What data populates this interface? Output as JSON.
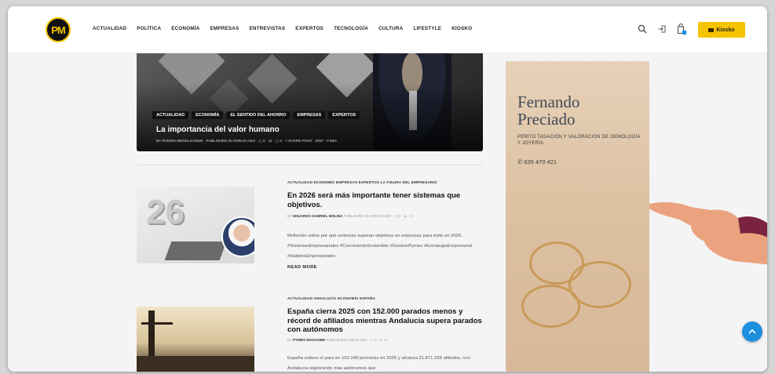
{
  "site": {
    "logo": "PM"
  },
  "nav": [
    "ACTUALIDAD",
    "POLÍTICA",
    "ECONOMÍA",
    "EMPRESAS",
    "ENTREVISTAS",
    "EXPERTOS",
    "TECNOLOGÍA",
    "CULTURA",
    "LIFESTYLE",
    "KIOSKO"
  ],
  "header": {
    "kiosko_label": "Kiosko",
    "accent": "#f5c400"
  },
  "featured": {
    "tags": [
      "ACTUALIDAD",
      "ECONOMÍA",
      "EL SENTIDO DEL AHORRO",
      "EMPRESAS",
      "EXPERTOS"
    ],
    "title": "La importancia del valor humano",
    "meta": "BY RAMÓN MEDELSANUM · PUBLISHED 20 HORAS AGO · ▢ 0 · 11 · ▢ 0 · < SHARE POST · 2007 · 0 MIN"
  },
  "posts": [
    {
      "tags": "ACTUALIDAD  ECONOMÍA  EMPRESAS  EXPERTOS  LA FIGURA DEL EMPRESARIO",
      "title": "En 2026 será más importante tener sistemas que objetivos.",
      "author": "EDUARDO GABRIEL MOLINA",
      "meta": "PUBLISHED 23 HORAS AGO · ▢ 0 · 11 · 0",
      "excerpt": "Reflexión sobre por qué sistemas superan objetivos en empresas para éxito en 2026. #SistemasEmpresariales #CrecimientoSostenible #GestionPymes #EstrategiaEmpresarial #HabitosEmpresariales",
      "read_more": "READ MORE",
      "image_text": "26"
    },
    {
      "tags": "ACTUALIDAD  ANDALUCÍA  ECONOMÍA  ESPAÑA",
      "title": "España cierra 2025 con 152.000 parados menos y récord de afiliados mientras Andalucía supera parados con autónomos",
      "author": "PYMES MAGAZINE",
      "meta": "PUBLISHED 2 DÍAS AGO · ▢ 0 · 1 · 0",
      "excerpt": "España reduce el paro en 152.048 personas en 2025 y alcanza 21.871.328 afiliados, con Andalucía registrando más autónomos que"
    }
  ],
  "ad": {
    "name_line1": "Fernando",
    "name_line2": "Preciado",
    "subtitle": "PERITO TASACIÓN Y VALORACIÓN DE GEMOLOGÍA Y JOYERÍA",
    "phone": "635 470 421"
  }
}
